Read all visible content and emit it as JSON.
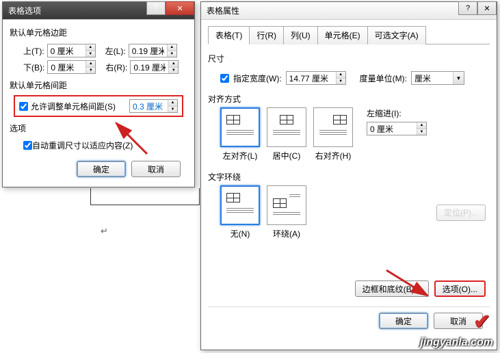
{
  "left": {
    "title": "表格选项",
    "margins_label": "默认单元格边距",
    "top_lbl": "上(T):",
    "top_val": "0 厘米",
    "left_lbl": "左(L):",
    "left_val": "0.19 厘米",
    "bottom_lbl": "下(B):",
    "bottom_val": "0 厘米",
    "right_lbl": "右(R):",
    "right_val": "0.19 厘米",
    "spacing_label": "默认单元格间距",
    "allow_spacing": "允许调整单元格间距(S)",
    "spacing_val": "0.3 厘米",
    "options_label": "选项",
    "autofit": "自动重调尺寸以适应内容(Z)",
    "ok": "确定",
    "cancel": "取消"
  },
  "right": {
    "title": "表格属性",
    "tabs": [
      "表格(T)",
      "行(R)",
      "列(U)",
      "单元格(E)",
      "可选文字(A)"
    ],
    "size_label": "尺寸",
    "pref_width": "指定宽度(W):",
    "width_val": "14.77 厘米",
    "measure_lbl": "度量单位(M):",
    "measure_val": "厘米",
    "align_label": "对齐方式",
    "indent_lbl": "左缩进(I):",
    "indent_val": "0 厘米",
    "align_left": "左对齐(L)",
    "align_center": "居中(C)",
    "align_right": "右对齐(H)",
    "wrap_label": "文字环绕",
    "wrap_none": "无(N)",
    "wrap_around": "环绕(A)",
    "pos_btn": "定位(P)...",
    "border_btn": "边框和底纹(B)...",
    "options_btn": "选项(O)...",
    "ok": "确定",
    "cancel": "取消"
  },
  "watermark": "jingyanla.com"
}
